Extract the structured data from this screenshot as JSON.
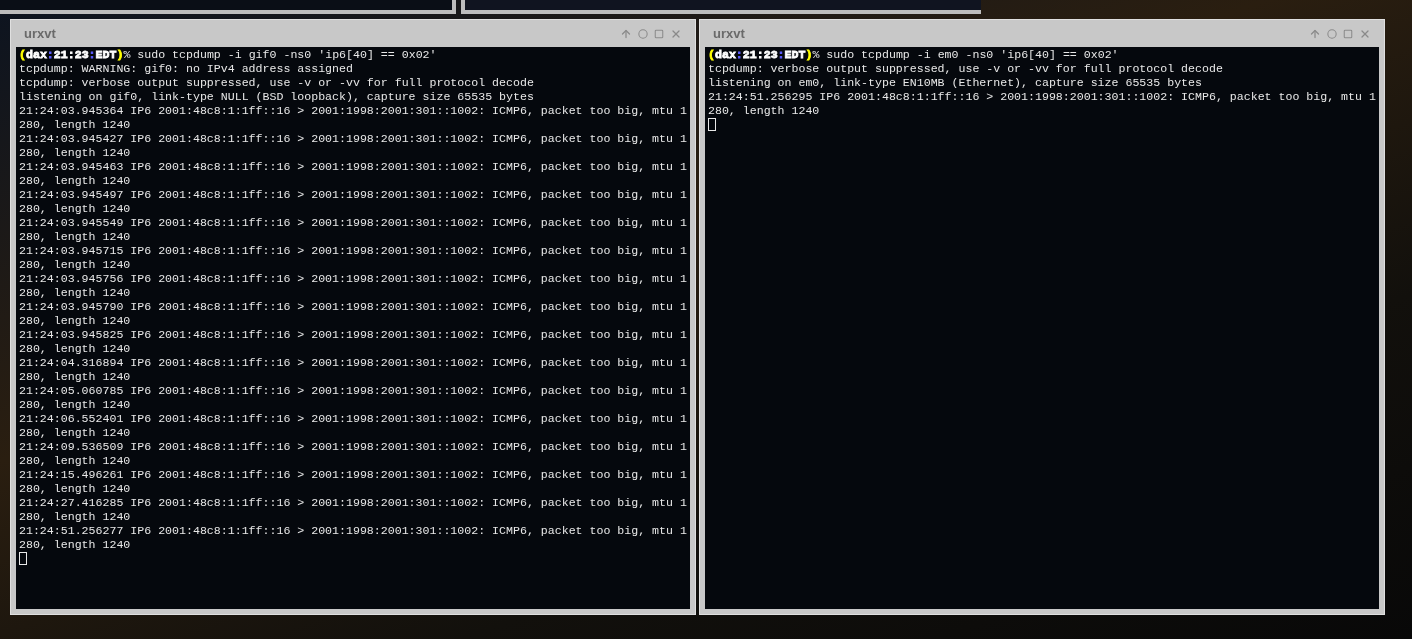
{
  "windows": [
    {
      "title": "urxvt",
      "prompt": [
        {
          "text": "(",
          "color": "#ffff00"
        },
        {
          "text": "dax",
          "color": "#ffffff"
        },
        {
          "text": ":",
          "color": "#5c5cff"
        },
        {
          "text": "21:23",
          "color": "#ffffff"
        },
        {
          "text": ":",
          "color": "#5c5cff"
        },
        {
          "text": "EDT",
          "color": "#ffffff"
        },
        {
          "text": ")",
          "color": "#ffff00"
        }
      ],
      "command": "% sudo tcpdump -i gif0 -ns0 'ip6[40] == 0x02'",
      "output": [
        "tcpdump: WARNING: gif0: no IPv4 address assigned",
        "tcpdump: verbose output suppressed, use -v or -vv for full protocol decode",
        "listening on gif0, link-type NULL (BSD loopback), capture size 65535 bytes",
        "21:24:03.945364 IP6 2001:48c8:1:1ff::16 > 2001:1998:2001:301::1002: ICMP6, packet too big, mtu 1",
        "280, length 1240",
        "21:24:03.945427 IP6 2001:48c8:1:1ff::16 > 2001:1998:2001:301::1002: ICMP6, packet too big, mtu 1",
        "280, length 1240",
        "21:24:03.945463 IP6 2001:48c8:1:1ff::16 > 2001:1998:2001:301::1002: ICMP6, packet too big, mtu 1",
        "280, length 1240",
        "21:24:03.945497 IP6 2001:48c8:1:1ff::16 > 2001:1998:2001:301::1002: ICMP6, packet too big, mtu 1",
        "280, length 1240",
        "21:24:03.945549 IP6 2001:48c8:1:1ff::16 > 2001:1998:2001:301::1002: ICMP6, packet too big, mtu 1",
        "280, length 1240",
        "21:24:03.945715 IP6 2001:48c8:1:1ff::16 > 2001:1998:2001:301::1002: ICMP6, packet too big, mtu 1",
        "280, length 1240",
        "21:24:03.945756 IP6 2001:48c8:1:1ff::16 > 2001:1998:2001:301::1002: ICMP6, packet too big, mtu 1",
        "280, length 1240",
        "21:24:03.945790 IP6 2001:48c8:1:1ff::16 > 2001:1998:2001:301::1002: ICMP6, packet too big, mtu 1",
        "280, length 1240",
        "21:24:03.945825 IP6 2001:48c8:1:1ff::16 > 2001:1998:2001:301::1002: ICMP6, packet too big, mtu 1",
        "280, length 1240",
        "21:24:04.316894 IP6 2001:48c8:1:1ff::16 > 2001:1998:2001:301::1002: ICMP6, packet too big, mtu 1",
        "280, length 1240",
        "21:24:05.060785 IP6 2001:48c8:1:1ff::16 > 2001:1998:2001:301::1002: ICMP6, packet too big, mtu 1",
        "280, length 1240",
        "21:24:06.552401 IP6 2001:48c8:1:1ff::16 > 2001:1998:2001:301::1002: ICMP6, packet too big, mtu 1",
        "280, length 1240",
        "21:24:09.536509 IP6 2001:48c8:1:1ff::16 > 2001:1998:2001:301::1002: ICMP6, packet too big, mtu 1",
        "280, length 1240",
        "21:24:15.496261 IP6 2001:48c8:1:1ff::16 > 2001:1998:2001:301::1002: ICMP6, packet too big, mtu 1",
        "280, length 1240",
        "21:24:27.416285 IP6 2001:48c8:1:1ff::16 > 2001:1998:2001:301::1002: ICMP6, packet too big, mtu 1",
        "280, length 1240",
        "21:24:51.256277 IP6 2001:48c8:1:1ff::16 > 2001:1998:2001:301::1002: ICMP6, packet too big, mtu 1",
        "280, length 1240"
      ]
    },
    {
      "title": "urxvt",
      "prompt": [
        {
          "text": "(",
          "color": "#ffff00"
        },
        {
          "text": "dax",
          "color": "#ffffff"
        },
        {
          "text": ":",
          "color": "#5c5cff"
        },
        {
          "text": "21:23",
          "color": "#ffffff"
        },
        {
          "text": ":",
          "color": "#5c5cff"
        },
        {
          "text": "EDT",
          "color": "#ffffff"
        },
        {
          "text": ")",
          "color": "#ffff00"
        }
      ],
      "command": "% sudo tcpdump -i em0 -ns0 'ip6[40] == 0x02'",
      "output": [
        "tcpdump: verbose output suppressed, use -v or -vv for full protocol decode",
        "listening on em0, link-type EN10MB (Ethernet), capture size 65535 bytes",
        "21:24:51.256295 IP6 2001:48c8:1:1ff::16 > 2001:1998:2001:301::1002: ICMP6, packet too big, mtu 1",
        "280, length 1240"
      ]
    }
  ]
}
